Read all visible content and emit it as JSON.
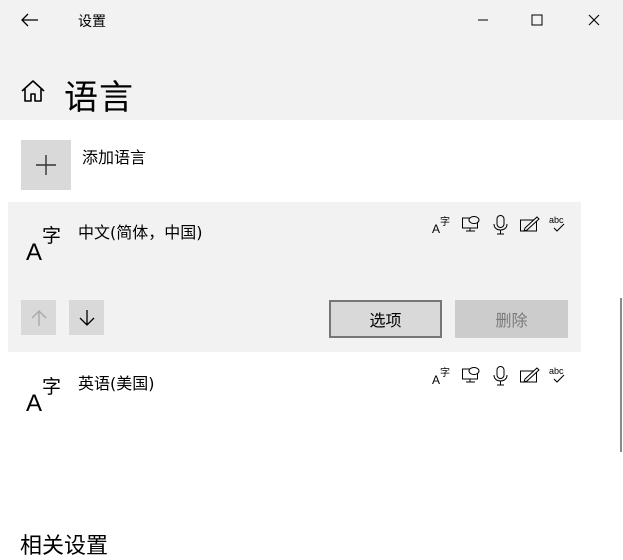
{
  "window": {
    "title": "设置"
  },
  "page": {
    "title": "语言"
  },
  "add_language": {
    "label": "添加语言"
  },
  "languages": [
    {
      "name": "中文(简体，中国)",
      "selected": true
    },
    {
      "name": "英语(美国)",
      "selected": false
    }
  ],
  "selected_actions": {
    "options_label": "选项",
    "remove_label": "删除"
  },
  "related": {
    "title": "相关设置"
  },
  "icons": {
    "back": "arrow-left-icon",
    "minimize": "minimize-icon",
    "maximize": "maximize-icon",
    "close": "close-icon",
    "home": "home-icon",
    "add": "plus-icon",
    "language": "language-icon",
    "capabilities": [
      "display-language-icon",
      "text-to-speech-icon",
      "speech-recognition-icon",
      "handwriting-icon",
      "spell-check-icon"
    ],
    "move_up": "arrow-up-icon",
    "move_down": "arrow-down-icon"
  }
}
